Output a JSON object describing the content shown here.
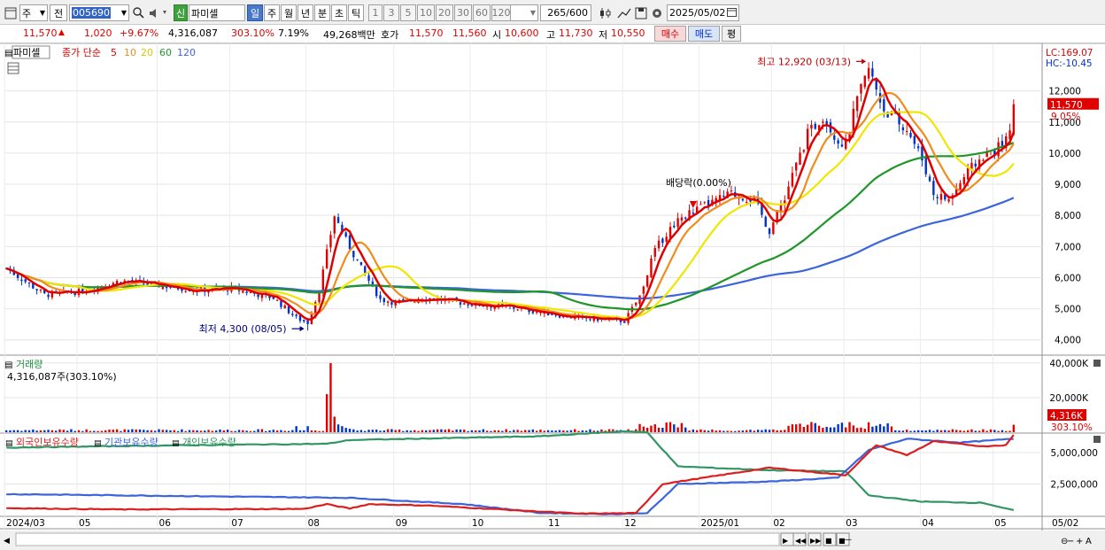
{
  "toolbar": {
    "market": "주",
    "period_prefix": "전",
    "code": "005690",
    "new_badge": "신",
    "stock_name": "파미셀",
    "periods": [
      "일",
      "주",
      "월",
      "년",
      "분",
      "초",
      "틱"
    ],
    "minute_options": [
      "1",
      "3",
      "5",
      "10",
      "20",
      "30",
      "60",
      "120"
    ],
    "count": "265",
    "count_total": "/600",
    "date": "2025/05/02"
  },
  "quote": {
    "price": "11,570",
    "change": "1,020",
    "change_pct": "+9.67%",
    "volume": "4,316,087",
    "volume_ratio": "303.10%",
    "turnover": "7.19%",
    "amount": "49,268백만",
    "bid_label": "호가",
    "ask": "11,570",
    "bid": "11,560",
    "open_label": "시",
    "open": "10,600",
    "high_label": "고",
    "high": "11,730",
    "low_label": "저",
    "low": "10,550",
    "buy_label": "매수",
    "sell_label": "매도",
    "eval_label": "평"
  },
  "price_panel": {
    "stock_label": "파미셀",
    "ma_title": "종가 단순",
    "ma_periods": [
      "5",
      "10",
      "20",
      "60",
      "120"
    ],
    "lc": "LC:169.07",
    "hc": "HC:-10.45",
    "high_annotation": "최고 12,920 (03/13)",
    "low_annotation": "최저 4,300 (08/05)",
    "dividend_annotation": "배당락(0.00%)",
    "last_price_tag": "11,570",
    "last_pct_tag": "9.05%"
  },
  "volume_panel": {
    "title": "거래량",
    "current": "4,316,087주(303.10%)",
    "last_tag": "4,316K",
    "last_pct": "303.10%"
  },
  "holding_panel": {
    "legend": [
      "외국인보유수량",
      "기관보유수량",
      "개인보유수량"
    ]
  },
  "colors": {
    "ma5": "#e00000",
    "ma10": "#f08c1e",
    "ma20": "#f0e600",
    "ma60": "#1e9628",
    "ma120": "#3c64dc",
    "up": "#e00000",
    "down": "#0032c8",
    "foreign": "#dc1e1e",
    "institution": "#3c64dc",
    "individual": "#329664"
  },
  "chart_data": [
    {
      "type": "candlestick",
      "title": "파미셀",
      "x_ticks": [
        "2024/03",
        "05",
        "06",
        "07",
        "08",
        "09",
        "10",
        "11",
        "12",
        "2025/01",
        "02",
        "03",
        "04",
        "05",
        "05/02"
      ],
      "y_ticks": [
        "4,000",
        "5,000",
        "6,000",
        "7,000",
        "8,000",
        "9,000",
        "10,000",
        "11,000",
        "12,000"
      ],
      "ylim": [
        3650,
        13300
      ],
      "series_close_monthly": [
        {
          "date": "2024/03",
          "close": 6100
        },
        {
          "date": "2024/04",
          "close": 5500
        },
        {
          "date": "2024/05",
          "close": 5700
        },
        {
          "date": "2024/06",
          "close": 5750
        },
        {
          "date": "2024/07",
          "close": 5450
        },
        {
          "date": "2024/08",
          "close": 5900
        },
        {
          "date": "2024/09",
          "close": 5300
        },
        {
          "date": "2024/10",
          "close": 5150
        },
        {
          "date": "2024/11",
          "close": 4750
        },
        {
          "date": "2024/12",
          "close": 7800
        },
        {
          "date": "2025/01",
          "close": 8400
        },
        {
          "date": "2025/02",
          "close": 10600
        },
        {
          "date": "2025/03",
          "close": 11200
        },
        {
          "date": "2025/04",
          "close": 9200
        },
        {
          "date": "2025/05/02",
          "close": 11570
        }
      ],
      "max": {
        "date": "03/13",
        "value": 12920
      },
      "min": {
        "date": "08/05",
        "value": 4300
      }
    },
    {
      "type": "bar",
      "title": "거래량",
      "y_ticks": [
        "20,000K",
        "40,000K"
      ],
      "ylim": [
        0,
        42000
      ],
      "last_value": 4316
    },
    {
      "type": "line",
      "legend": [
        "외국인보유수량",
        "기관보유수량",
        "개인보유수량"
      ],
      "y_ticks": [
        "2,500,000",
        "5,000,000"
      ]
    }
  ]
}
